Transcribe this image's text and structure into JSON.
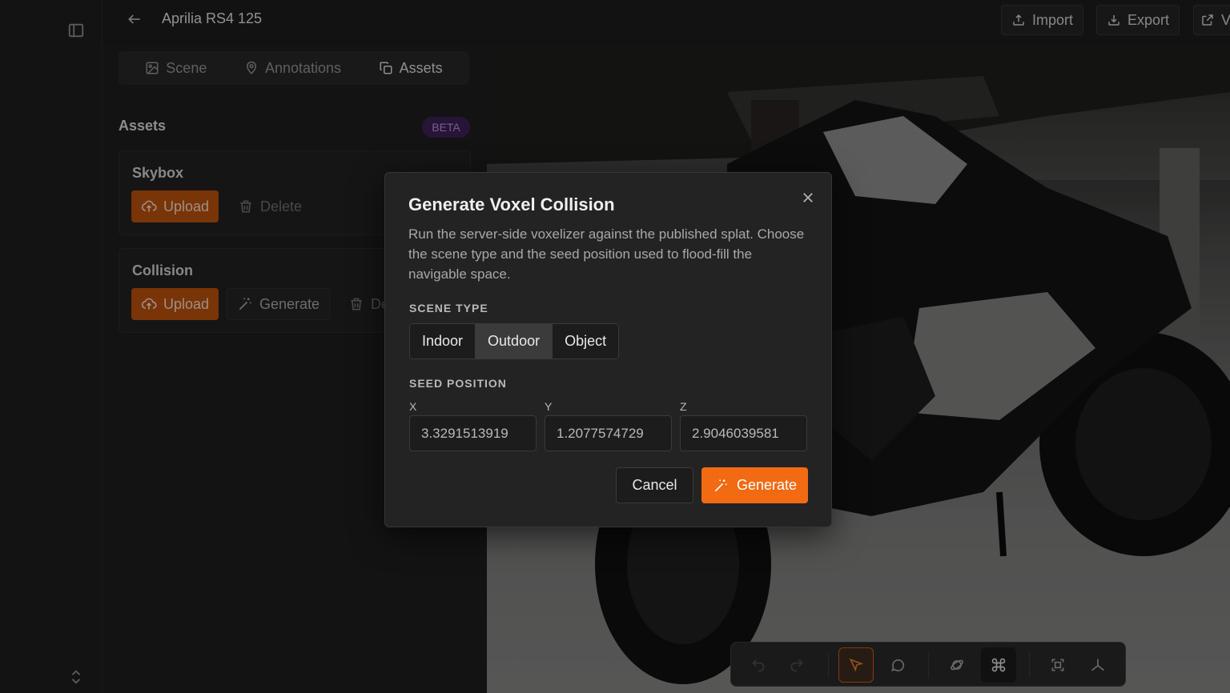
{
  "header": {
    "title": "Aprilia RS4 125",
    "import_label": "Import",
    "export_label": "Export",
    "view_label": "V"
  },
  "tabs": [
    {
      "label": "Scene",
      "icon": "image-icon"
    },
    {
      "label": "Annotations",
      "icon": "map-pin-icon"
    },
    {
      "label": "Assets",
      "icon": "copy-icon"
    }
  ],
  "assets": {
    "title": "Assets",
    "badge": "BETA",
    "skybox": {
      "title": "Skybox",
      "upload": "Upload",
      "delete": "Delete"
    },
    "collision": {
      "title": "Collision",
      "upload": "Upload",
      "generate": "Generate",
      "delete": "De"
    }
  },
  "modal": {
    "title": "Generate Voxel Collision",
    "description": "Run the server-side voxelizer against the published splat. Choose the scene type and the seed position used to flood-fill the navigable space.",
    "scene_type_label": "SCENE TYPE",
    "scene_types": [
      "Indoor",
      "Outdoor",
      "Object"
    ],
    "selected_scene_type": "Outdoor",
    "seed_label": "SEED POSITION",
    "x_label": "X",
    "y_label": "Y",
    "z_label": "Z",
    "x_value": "3.3291513919",
    "y_value": "1.2077574729",
    "z_value": "2.9046039581",
    "cancel": "Cancel",
    "generate": "Generate"
  },
  "colors": {
    "accent": "#f26b13",
    "beta_bg": "#3a1f52",
    "beta_text": "#b48ad8"
  }
}
